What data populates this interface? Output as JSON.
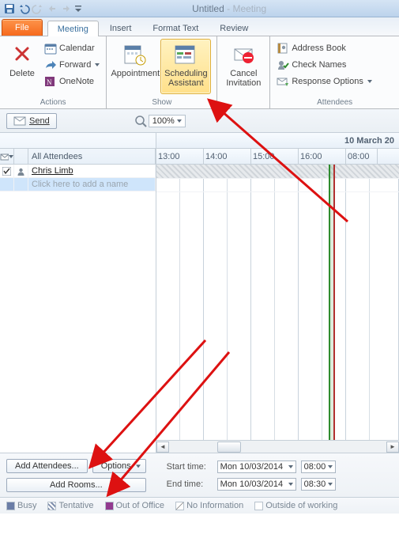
{
  "title": {
    "docname": "Untitled",
    "sep": " -  ",
    "apptype": "Meeting"
  },
  "tabs": {
    "file": "File",
    "meeting": "Meeting",
    "insert": "Insert",
    "format": "Format Text",
    "review": "Review"
  },
  "ribbon": {
    "actions": {
      "delete": "Delete",
      "calendar": "Calendar",
      "forward": "Forward",
      "onenote": "OneNote",
      "group": "Actions"
    },
    "show": {
      "appointment": "Appointment",
      "sched1": "Scheduling",
      "sched2": "Assistant",
      "group": "Show"
    },
    "cancel": {
      "l1": "Cancel",
      "l2": "Invitation"
    },
    "attendees": {
      "ab": "Address Book",
      "cn": "Check Names",
      "ro": "Response Options",
      "group": "Attendees"
    }
  },
  "toolbar": {
    "send": "Send",
    "zoom": "100%"
  },
  "attendees": {
    "header": "All Attendees",
    "rows": [
      {
        "name": "Chris Limb",
        "org": true
      }
    ],
    "hint": "Click here to add a name"
  },
  "timeline": {
    "date": "10 March 20",
    "hours": [
      "13:00",
      "14:00",
      "15:00",
      "16:00"
    ],
    "morning": "08:00"
  },
  "footer": {
    "addAtt": "Add Attendees...",
    "options": "Options",
    "addRooms": "Add Rooms...",
    "startLbl": "Start time:",
    "endLbl": "End time:",
    "startDate": "Mon 10/03/2014",
    "startTime": "08:00",
    "endDate": "Mon 10/03/2014",
    "endTime": "08:30"
  },
  "legend": {
    "busy": "Busy",
    "tent": "Tentative",
    "oof": "Out of Office",
    "noinfo": "No Information",
    "out": "Outside of working"
  }
}
